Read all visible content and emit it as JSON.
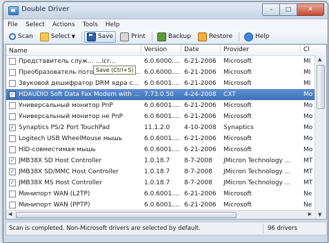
{
  "window": {
    "title": "Double Driver"
  },
  "menu": [
    "File",
    "Select",
    "Actions",
    "Tools",
    "Help"
  ],
  "toolbar": {
    "scan": "Scan",
    "select": "Select",
    "save": "Save",
    "print": "Print",
    "backup": "Backup",
    "restore": "Restore",
    "help": "Help"
  },
  "tooltip": "Save (Ctrl+S)",
  "columns": {
    "name": "Name",
    "version": "Version",
    "date": "Date",
    "provider": "Provider",
    "class": "Cl"
  },
  "rows": [
    {
      "checked": false,
      "selected": false,
      "name": "Представитель служ… …icr…",
      "version": "6.0.6000....",
      "date": "6-21-2006",
      "provider": "Microsoft",
      "cls": "MI"
    },
    {
      "checked": false,
      "selected": false,
      "name": "Преобразователь потоков Tee/Sink-...",
      "version": "6.0.6000....",
      "date": "6-21-2006",
      "provider": "Microsoft",
      "cls": "MI"
    },
    {
      "checked": false,
      "selected": false,
      "name": "Звуковой дешифратор DRM ядра си...",
      "version": "6.0.6001....",
      "date": "6-21-2006",
      "provider": "Microsoft",
      "cls": "MI"
    },
    {
      "checked": true,
      "selected": true,
      "name": "HDAUDIO Soft Data Fax Modem with ...",
      "version": "7.73.0.50",
      "date": "4-24-2008",
      "provider": "CXT",
      "cls": "Mo"
    },
    {
      "checked": false,
      "selected": false,
      "name": "Универсальный монитор PnP",
      "version": "6.0.6001....",
      "date": "6-21-2006",
      "provider": "Microsoft",
      "cls": "Mo"
    },
    {
      "checked": false,
      "selected": false,
      "name": "Универсальный монитор не PnP",
      "version": "6.0.6001....",
      "date": "6-21-2006",
      "provider": "Microsoft",
      "cls": "Mo"
    },
    {
      "checked": true,
      "selected": false,
      "name": "Synaptics PS/2 Port TouchPad",
      "version": "11.1.2.0",
      "date": "4-10-2008",
      "provider": "Synaptics",
      "cls": "Mo"
    },
    {
      "checked": false,
      "selected": false,
      "name": "Logitech USB WheelMouse мышь",
      "version": "6.0.6001....",
      "date": "6-21-2006",
      "provider": "Microsoft",
      "cls": "Mo"
    },
    {
      "checked": false,
      "selected": false,
      "name": "HID-совместимая мышь",
      "version": "6.0.6001....",
      "date": "6-21-2006",
      "provider": "Microsoft",
      "cls": "Mo"
    },
    {
      "checked": true,
      "selected": false,
      "name": "JMB38X SD Host Controller",
      "version": "1.0.18.7",
      "date": "8-7-2008",
      "provider": "JMicron Technology ...",
      "cls": "MT"
    },
    {
      "checked": true,
      "selected": false,
      "name": "JMB38X SD/MMC Host Controller",
      "version": "1.0.18.7",
      "date": "8-7-2008",
      "provider": "JMicron Technology ...",
      "cls": "MT"
    },
    {
      "checked": true,
      "selected": false,
      "name": "JMB38X MS Host Controller",
      "version": "1.0.18.7",
      "date": "8-7-2008",
      "provider": "JMicron Technology ...",
      "cls": "MT"
    },
    {
      "checked": false,
      "selected": false,
      "name": "Минипорт WAN (L2TP)",
      "version": "6.0.6001....",
      "date": "6-21-2006",
      "provider": "Microsoft",
      "cls": "Ne"
    },
    {
      "checked": false,
      "selected": false,
      "name": "Минипорт WAN (PPTP)",
      "version": "6.0.6001....",
      "date": "6-21-2006",
      "provider": "Microsoft",
      "cls": "Ne"
    }
  ],
  "status": {
    "message": "Scan is completed. Non-Microsoft drivers are selected by default.",
    "count": "96 drivers"
  }
}
